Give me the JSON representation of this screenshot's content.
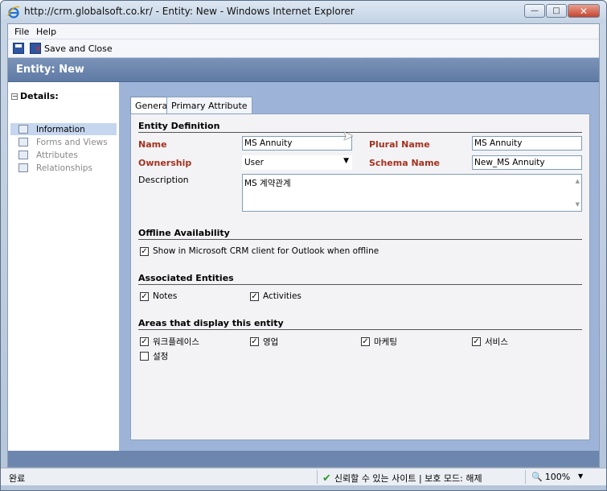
{
  "window": {
    "title": "http://crm.globalsoft.co.kr/ - Entity: New - Windows Internet Explorer",
    "minimize": "—",
    "maximize": "□",
    "close": "✕"
  },
  "menu": {
    "file": "File",
    "help": "Help"
  },
  "toolbar": {
    "save_and_close": "Save and Close"
  },
  "entity_header": {
    "title": "Entity: New"
  },
  "nav": {
    "group_label": "Details:",
    "toggle": "−",
    "items": [
      {
        "label": "Information",
        "icon": "info-icon",
        "selected": true
      },
      {
        "label": "Forms and Views",
        "icon": "forms-icon",
        "selected": false
      },
      {
        "label": "Attributes",
        "icon": "attributes-icon",
        "selected": false
      },
      {
        "label": "Relationships",
        "icon": "relationships-icon",
        "selected": false
      }
    ]
  },
  "tabs": [
    {
      "label": "General",
      "active": true
    },
    {
      "label": "Primary Attribute",
      "active": false
    }
  ],
  "entity_definition": {
    "title": "Entity Definition",
    "name_label": "Name",
    "name_value": "MS Annuity",
    "plural_label": "Plural Name",
    "plural_value": "MS Annuity",
    "ownership_label": "Ownership",
    "ownership_value": "User",
    "schema_label": "Schema Name",
    "schema_value": "New_MS Annuity",
    "description_label": "Description",
    "description_value": "MS 계약관계"
  },
  "offline": {
    "title": "Offline Availability",
    "option": "Show in Microsoft CRM client for Outlook when offline",
    "checked": true
  },
  "associated": {
    "title": "Associated Entities",
    "items": [
      {
        "label": "Notes",
        "checked": true
      },
      {
        "label": "Activities",
        "checked": true
      }
    ]
  },
  "areas": {
    "title": "Areas that display this entity",
    "items": [
      {
        "label": "워크플레이스",
        "checked": true
      },
      {
        "label": "영업",
        "checked": true
      },
      {
        "label": "마케팅",
        "checked": true
      },
      {
        "label": "서비스",
        "checked": true
      },
      {
        "label": "설정",
        "checked": false
      }
    ]
  },
  "status": {
    "left": "완료",
    "trust": "신뢰할 수 있는 사이트 | 보호 모드: 해제",
    "zoom": "100%"
  },
  "colors": {
    "required_label": "#a3321e",
    "header_bg": "#6d86ae",
    "main_bg": "#9db4d8"
  }
}
